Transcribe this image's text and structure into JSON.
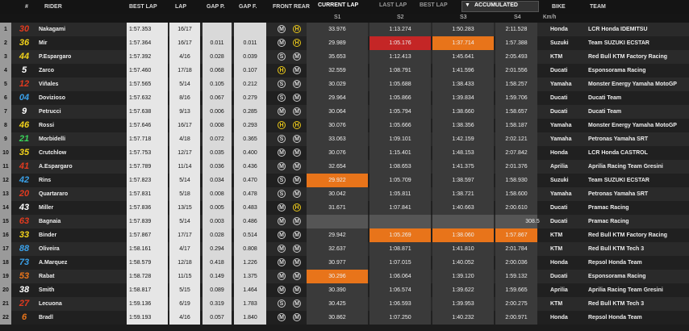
{
  "header": {
    "hash": "#",
    "rider": "RIDER",
    "best_lap": "BEST LAP",
    "lap": "LAP",
    "gap_p": "GAP P.",
    "gap_f": "GAP F.",
    "front_rear": "FRONT REAR",
    "current_lap": "CURRENT LAP",
    "last_lap": "LAST LAP",
    "best_lap_tab": "BEST LAP",
    "accumulated": "ACCUMULATED",
    "bike": "BIKE",
    "team": "TEAM",
    "s1": "S1",
    "s2": "S2",
    "s3": "S3",
    "s4": "S4",
    "kmh": "Km/h"
  },
  "colors": {
    "red": "#c42626",
    "orange": "#e8741a",
    "hard": "#e8c61a"
  },
  "rows": [
    {
      "pos": "1",
      "num": "30",
      "numColor": "#e03a1f",
      "rider": "Nakagami",
      "best": "1:57.353",
      "lap": "16/17",
      "gp": "",
      "gf": "",
      "f": "M",
      "r": "H",
      "s1": "33.976",
      "s2": "1:13.274",
      "s3": "1:50.283",
      "s4": "2:11.528",
      "spd": "",
      "bike": "Honda",
      "team": "LCR Honda IDEMITSU"
    },
    {
      "pos": "2",
      "num": "36",
      "numColor": "#f2d21b",
      "rider": "Mir",
      "best": "1:57.364",
      "lap": "16/17",
      "gp": "0.011",
      "gf": "0.011",
      "f": "M",
      "r": "H",
      "s1": "29.989",
      "s2": "1:05.176",
      "s3": "1:37.714",
      "s4": "1:57.388",
      "spd": "",
      "bike": "Suzuki",
      "team": "Team SUZUKI ECSTAR",
      "hl2": "red",
      "hl3": "orange"
    },
    {
      "pos": "3",
      "num": "44",
      "numColor": "#f2d21b",
      "rider": "P.Espargaro",
      "best": "1:57.392",
      "lap": "4/16",
      "gp": "0.028",
      "gf": "0.039",
      "f": "S",
      "r": "M",
      "s1": "35.653",
      "s2": "1:12.413",
      "s3": "1:45.641",
      "s4": "2:05.493",
      "spd": "",
      "bike": "KTM",
      "team": "Red Bull KTM Factory Racing"
    },
    {
      "pos": "4",
      "num": "5",
      "numColor": "#ffffff",
      "rider": "Zarco",
      "best": "1:57.460",
      "lap": "17/18",
      "gp": "0.068",
      "gf": "0.107",
      "f": "H",
      "r": "M",
      "s1": "32.559",
      "s2": "1:08.791",
      "s3": "1:41.596",
      "s4": "2:01.556",
      "spd": "",
      "bike": "Ducati",
      "team": "Esponsorama Racing"
    },
    {
      "pos": "5",
      "num": "12",
      "numColor": "#e03a1f",
      "rider": "Viñales",
      "best": "1:57.565",
      "lap": "5/14",
      "gp": "0.105",
      "gf": "0.212",
      "f": "S",
      "r": "M",
      "s1": "30.029",
      "s2": "1:05.688",
      "s3": "1:38.433",
      "s4": "1:58.257",
      "spd": "",
      "bike": "Yamaha",
      "team": "Monster Energy Yamaha MotoGP"
    },
    {
      "pos": "6",
      "num": "04",
      "numColor": "#3aa0e8",
      "rider": "Dovizioso",
      "best": "1:57.632",
      "lap": "8/16",
      "gp": "0.067",
      "gf": "0.279",
      "f": "S",
      "r": "M",
      "s1": "29.964",
      "s2": "1:05.866",
      "s3": "1:39.834",
      "s4": "1:59.706",
      "spd": "",
      "bike": "Ducati",
      "team": "Ducati Team"
    },
    {
      "pos": "7",
      "num": "9",
      "numColor": "#ffffff",
      "rider": "Petrucci",
      "best": "1:57.638",
      "lap": "9/13",
      "gp": "0.006",
      "gf": "0.285",
      "f": "M",
      "r": "M",
      "s1": "30.064",
      "s2": "1:05.794",
      "s3": "1:38.660",
      "s4": "1:58.657",
      "spd": "",
      "bike": "Ducati",
      "team": "Ducati Team"
    },
    {
      "pos": "8",
      "num": "46",
      "numColor": "#f2d21b",
      "rider": "Rossi",
      "best": "1:57.646",
      "lap": "16/17",
      "gp": "0.008",
      "gf": "0.293",
      "f": "H",
      "r": "H",
      "s1": "30.076",
      "s2": "1:05.666",
      "s3": "1:38.356",
      "s4": "1:58.187",
      "spd": "",
      "bike": "Yamaha",
      "team": "Monster Energy Yamaha MotoGP"
    },
    {
      "pos": "9",
      "num": "21",
      "numColor": "#3ad25a",
      "rider": "Morbidelli",
      "best": "1:57.718",
      "lap": "4/18",
      "gp": "0.072",
      "gf": "0.365",
      "f": "S",
      "r": "M",
      "s1": "33.063",
      "s2": "1:09.101",
      "s3": "1:42.159",
      "s4": "2:02.121",
      "spd": "",
      "bike": "Yamaha",
      "team": "Petronas Yamaha SRT"
    },
    {
      "pos": "10",
      "num": "35",
      "numColor": "#f2d21b",
      "rider": "Crutchlow",
      "best": "1:57.753",
      "lap": "12/17",
      "gp": "0.035",
      "gf": "0.400",
      "f": "M",
      "r": "M",
      "s1": "30.076",
      "s2": "1:15.401",
      "s3": "1:48.153",
      "s4": "2:07.842",
      "spd": "",
      "bike": "Honda",
      "team": "LCR Honda CASTROL"
    },
    {
      "pos": "11",
      "num": "41",
      "numColor": "#e03a1f",
      "rider": "A.Espargaro",
      "best": "1:57.789",
      "lap": "11/14",
      "gp": "0.036",
      "gf": "0.436",
      "f": "M",
      "r": "M",
      "s1": "32.654",
      "s2": "1:08.653",
      "s3": "1:41.375",
      "s4": "2:01.376",
      "spd": "",
      "bike": "Aprilia",
      "team": "Aprilia Racing Team Gresini"
    },
    {
      "pos": "12",
      "num": "42",
      "numColor": "#3aa0e8",
      "rider": "Rins",
      "best": "1:57.823",
      "lap": "5/14",
      "gp": "0.034",
      "gf": "0.470",
      "f": "S",
      "r": "M",
      "s1": "29.922",
      "s2": "1:05.709",
      "s3": "1:38.597",
      "s4": "1:58.930",
      "spd": "",
      "bike": "Suzuki",
      "team": "Team SUZUKI ECSTAR",
      "hl1": "orange"
    },
    {
      "pos": "13",
      "num": "20",
      "numColor": "#e03a1f",
      "rider": "Quartararo",
      "best": "1:57.831",
      "lap": "5/18",
      "gp": "0.008",
      "gf": "0.478",
      "f": "S",
      "r": "M",
      "s1": "30.042",
      "s2": "1:05.811",
      "s3": "1:38.721",
      "s4": "1:58.600",
      "spd": "",
      "bike": "Yamaha",
      "team": "Petronas Yamaha SRT"
    },
    {
      "pos": "14",
      "num": "43",
      "numColor": "#ffffff",
      "rider": "Miller",
      "best": "1:57.836",
      "lap": "13/15",
      "gp": "0.005",
      "gf": "0.483",
      "f": "M",
      "r": "H",
      "s1": "31.671",
      "s2": "1:07.841",
      "s3": "1:40.663",
      "s4": "2:00.610",
      "spd": "",
      "bike": "Ducati",
      "team": "Pramac Racing"
    },
    {
      "pos": "15",
      "num": "63",
      "numColor": "#e03a1f",
      "rider": "Bagnaia",
      "best": "1:57.839",
      "lap": "5/14",
      "gp": "0.003",
      "gf": "0.486",
      "f": "M",
      "r": "M",
      "s1": "",
      "s2": "",
      "s3": "",
      "s4": "",
      "spd": "308.5",
      "bike": "Ducati",
      "team": "Pramac Racing",
      "greyRow": true
    },
    {
      "pos": "16",
      "num": "33",
      "numColor": "#f2d21b",
      "rider": "Binder",
      "best": "1:57.867",
      "lap": "17/17",
      "gp": "0.028",
      "gf": "0.514",
      "f": "M",
      "r": "M",
      "s1": "29.942",
      "s2": "1:05.269",
      "s3": "1:38.060",
      "s4": "1:57.867",
      "spd": "",
      "bike": "KTM",
      "team": "Red Bull KTM Factory Racing",
      "hl2": "orange",
      "hl3": "orange",
      "hl4": "orange"
    },
    {
      "pos": "17",
      "num": "88",
      "numColor": "#3aa0e8",
      "rider": "Oliveira",
      "best": "1:58.161",
      "lap": "4/17",
      "gp": "0.294",
      "gf": "0.808",
      "f": "M",
      "r": "M",
      "s1": "32.637",
      "s2": "1:08.871",
      "s3": "1:41.810",
      "s4": "2:01.784",
      "spd": "",
      "bike": "KTM",
      "team": "Red Bull KTM Tech 3"
    },
    {
      "pos": "18",
      "num": "73",
      "numColor": "#3aa0e8",
      "rider": "A.Marquez",
      "best": "1:58.579",
      "lap": "12/18",
      "gp": "0.418",
      "gf": "1.226",
      "f": "M",
      "r": "M",
      "s1": "30.977",
      "s2": "1:07.015",
      "s3": "1:40.052",
      "s4": "2:00.036",
      "spd": "",
      "bike": "Honda",
      "team": "Repsol Honda Team"
    },
    {
      "pos": "19",
      "num": "53",
      "numColor": "#e8741a",
      "rider": "Rabat",
      "best": "1:58.728",
      "lap": "11/15",
      "gp": "0.149",
      "gf": "1.375",
      "f": "M",
      "r": "M",
      "s1": "30.296",
      "s2": "1:06.064",
      "s3": "1:39.120",
      "s4": "1:59.132",
      "spd": "",
      "bike": "Ducati",
      "team": "Esponsorama Racing",
      "hl1": "orange"
    },
    {
      "pos": "20",
      "num": "38",
      "numColor": "#ffffff",
      "rider": "Smith",
      "best": "1:58.817",
      "lap": "5/15",
      "gp": "0.089",
      "gf": "1.464",
      "f": "M",
      "r": "M",
      "s1": "30.390",
      "s2": "1:06.574",
      "s3": "1:39.622",
      "s4": "1:59.665",
      "spd": "",
      "bike": "Aprilia",
      "team": "Aprilia Racing Team Gresini"
    },
    {
      "pos": "21",
      "num": "27",
      "numColor": "#e03a1f",
      "rider": "Lecuona",
      "best": "1:59.136",
      "lap": "6/19",
      "gp": "0.319",
      "gf": "1.783",
      "f": "S",
      "r": "M",
      "s1": "30.425",
      "s2": "1:06.593",
      "s3": "1:39.953",
      "s4": "2:00.275",
      "spd": "",
      "bike": "KTM",
      "team": "Red Bull KTM Tech 3"
    },
    {
      "pos": "22",
      "num": "6",
      "numColor": "#e8741a",
      "rider": "Bradl",
      "best": "1:59.193",
      "lap": "4/16",
      "gp": "0.057",
      "gf": "1.840",
      "f": "M",
      "r": "M",
      "s1": "30.862",
      "s2": "1:07.250",
      "s3": "1:40.232",
      "s4": "2:00.971",
      "spd": "",
      "bike": "Honda",
      "team": "Repsol Honda Team"
    }
  ]
}
